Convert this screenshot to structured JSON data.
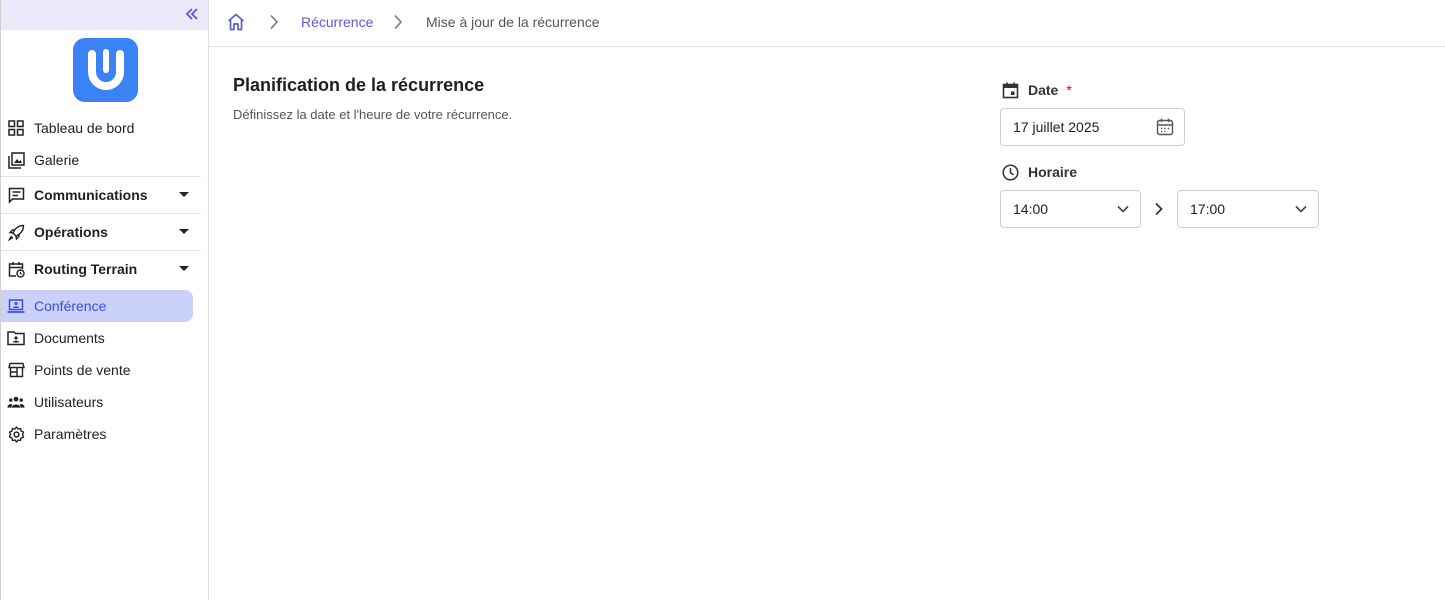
{
  "sidebar": {
    "items": [
      {
        "label": "Tableau de bord",
        "icon": "grid-icon"
      },
      {
        "label": "Galerie",
        "icon": "gallery-icon"
      }
    ],
    "groups": [
      {
        "label": "Communications",
        "icon": "message-icon"
      },
      {
        "label": "Opérations",
        "icon": "rocket-icon"
      },
      {
        "label": "Routing Terrain",
        "icon": "calendar-clock-icon"
      }
    ],
    "bottom_items": [
      {
        "label": "Conférence",
        "icon": "laptop-user-icon",
        "active": true
      },
      {
        "label": "Documents",
        "icon": "folder-user-icon"
      },
      {
        "label": "Points de vente",
        "icon": "storefront-icon"
      },
      {
        "label": "Utilisateurs",
        "icon": "users-icon"
      },
      {
        "label": "Paramètres",
        "icon": "gear-icon"
      }
    ]
  },
  "breadcrumb": {
    "link": "Récurrence",
    "current": "Mise à jour de la récurrence"
  },
  "section": {
    "title": "Planification de la récurrence",
    "description": "Définissez la date et l'heure de votre récurrence."
  },
  "date_field": {
    "label": "Date",
    "required_mark": "*",
    "value": "17 juillet 2025"
  },
  "time_field": {
    "label": "Horaire",
    "start": "14:00",
    "end": "17:00"
  },
  "colors": {
    "accent": "#5b5bd6",
    "active_bg": "#c9d1fb",
    "logo": "#3b82f6",
    "required": "#d0021b"
  }
}
